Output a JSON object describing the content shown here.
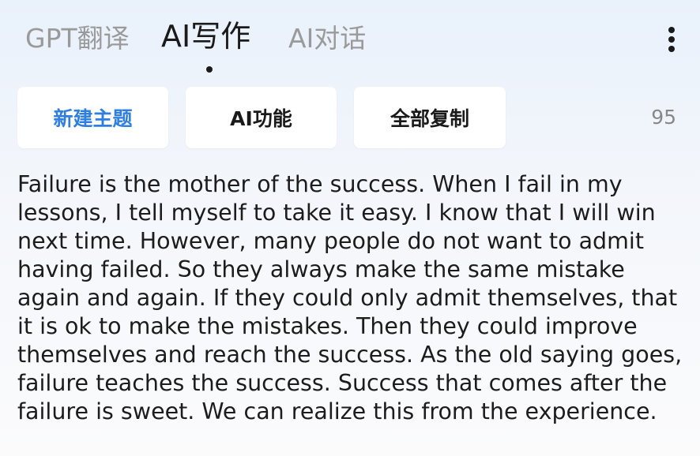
{
  "tabs": [
    {
      "label": "GPT翻译",
      "active": false
    },
    {
      "label": "AI写作",
      "active": true
    },
    {
      "label": "AI对话",
      "active": false
    }
  ],
  "menu": {
    "icon": "more-vertical-icon"
  },
  "toolbar": {
    "new_topic_label": "新建主题",
    "ai_functions_label": "AI功能",
    "copy_all_label": "全部复制",
    "char_count": "95"
  },
  "content": {
    "text": "Failure is the mother of the success. When I fail in my lessons, I tell myself to take it easy. I know that I will win next time. However, many people do not want to admit having failed. So they always make the same mistake again and again. If they could only admit themselves, that it is ok to make the mistakes. Then they could improve themselves and reach the success. As the old saying goes, failure teaches the success. Success that comes after the failure is sweet. We can realize this from the experience."
  },
  "colors": {
    "accent": "#2f7fe0",
    "active_tab": "#1a1a1a",
    "inactive_tab": "#9a9a9a",
    "background_top": "#e9f1fb",
    "background_bottom": "#fbfbfc"
  }
}
